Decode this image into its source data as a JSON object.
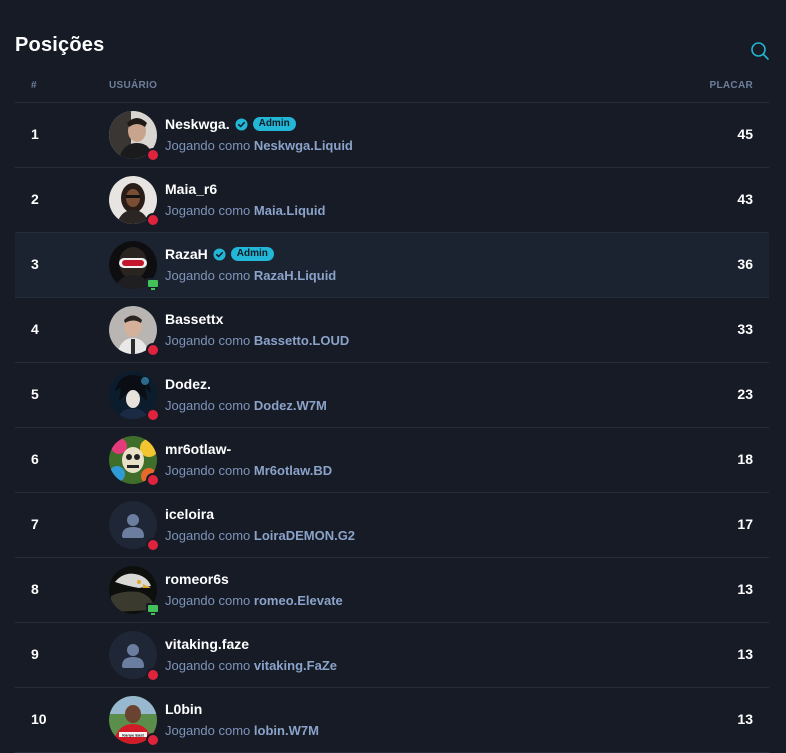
{
  "page": {
    "title": "Posições"
  },
  "table": {
    "headers": {
      "rank": "#",
      "user": "USUÁRIO",
      "score": "PLACAR"
    },
    "playing_as_label": "Jogando como",
    "rows": [
      {
        "rank": "1",
        "username": "Neskwga.",
        "verified": true,
        "badge": "Admin",
        "agent": "Neskwga.Liquid",
        "score": "45",
        "status": "offline",
        "avatar": "photo"
      },
      {
        "rank": "2",
        "username": "Maia_r6",
        "verified": false,
        "badge": "",
        "agent": "Maia.Liquid",
        "score": "43",
        "status": "offline",
        "avatar": "photo"
      },
      {
        "rank": "3",
        "username": "RazaH",
        "verified": true,
        "badge": "Admin",
        "agent": "RazaH.Liquid",
        "score": "36",
        "status": "online",
        "avatar": "photo"
      },
      {
        "rank": "4",
        "username": "Bassettx",
        "verified": false,
        "badge": "",
        "agent": "Bassetto.LOUD",
        "score": "33",
        "status": "offline",
        "avatar": "photo"
      },
      {
        "rank": "5",
        "username": "Dodez.",
        "verified": false,
        "badge": "",
        "agent": "Dodez.W7M",
        "score": "23",
        "status": "offline",
        "avatar": "photo"
      },
      {
        "rank": "6",
        "username": "mr6otlaw-",
        "verified": false,
        "badge": "",
        "agent": "Mr6otlaw.BD",
        "score": "18",
        "status": "offline",
        "avatar": "photo"
      },
      {
        "rank": "7",
        "username": "iceloira",
        "verified": false,
        "badge": "",
        "agent": "LoiraDEMON.G2",
        "score": "17",
        "status": "offline",
        "avatar": "default"
      },
      {
        "rank": "8",
        "username": "romeor6s",
        "verified": false,
        "badge": "",
        "agent": "romeo.Elevate",
        "score": "13",
        "status": "online",
        "avatar": "photo"
      },
      {
        "rank": "9",
        "username": "vitaking.faze",
        "verified": false,
        "badge": "",
        "agent": "vitaking.FaZe",
        "score": "13",
        "status": "offline",
        "avatar": "default"
      },
      {
        "rank": "10",
        "username": "L0bin",
        "verified": false,
        "badge": "",
        "agent": "lobin.W7M",
        "score": "13",
        "status": "offline",
        "avatar": "photo"
      }
    ]
  },
  "colors": {
    "background": "#161b26",
    "highlight_row": "#1c2330",
    "accent": "#22b7d6",
    "offline": "#e0233d",
    "online": "#44c25a"
  },
  "icons": {
    "search": "search-icon",
    "verified": "verified-check-icon",
    "default_avatar": "user-icon"
  }
}
